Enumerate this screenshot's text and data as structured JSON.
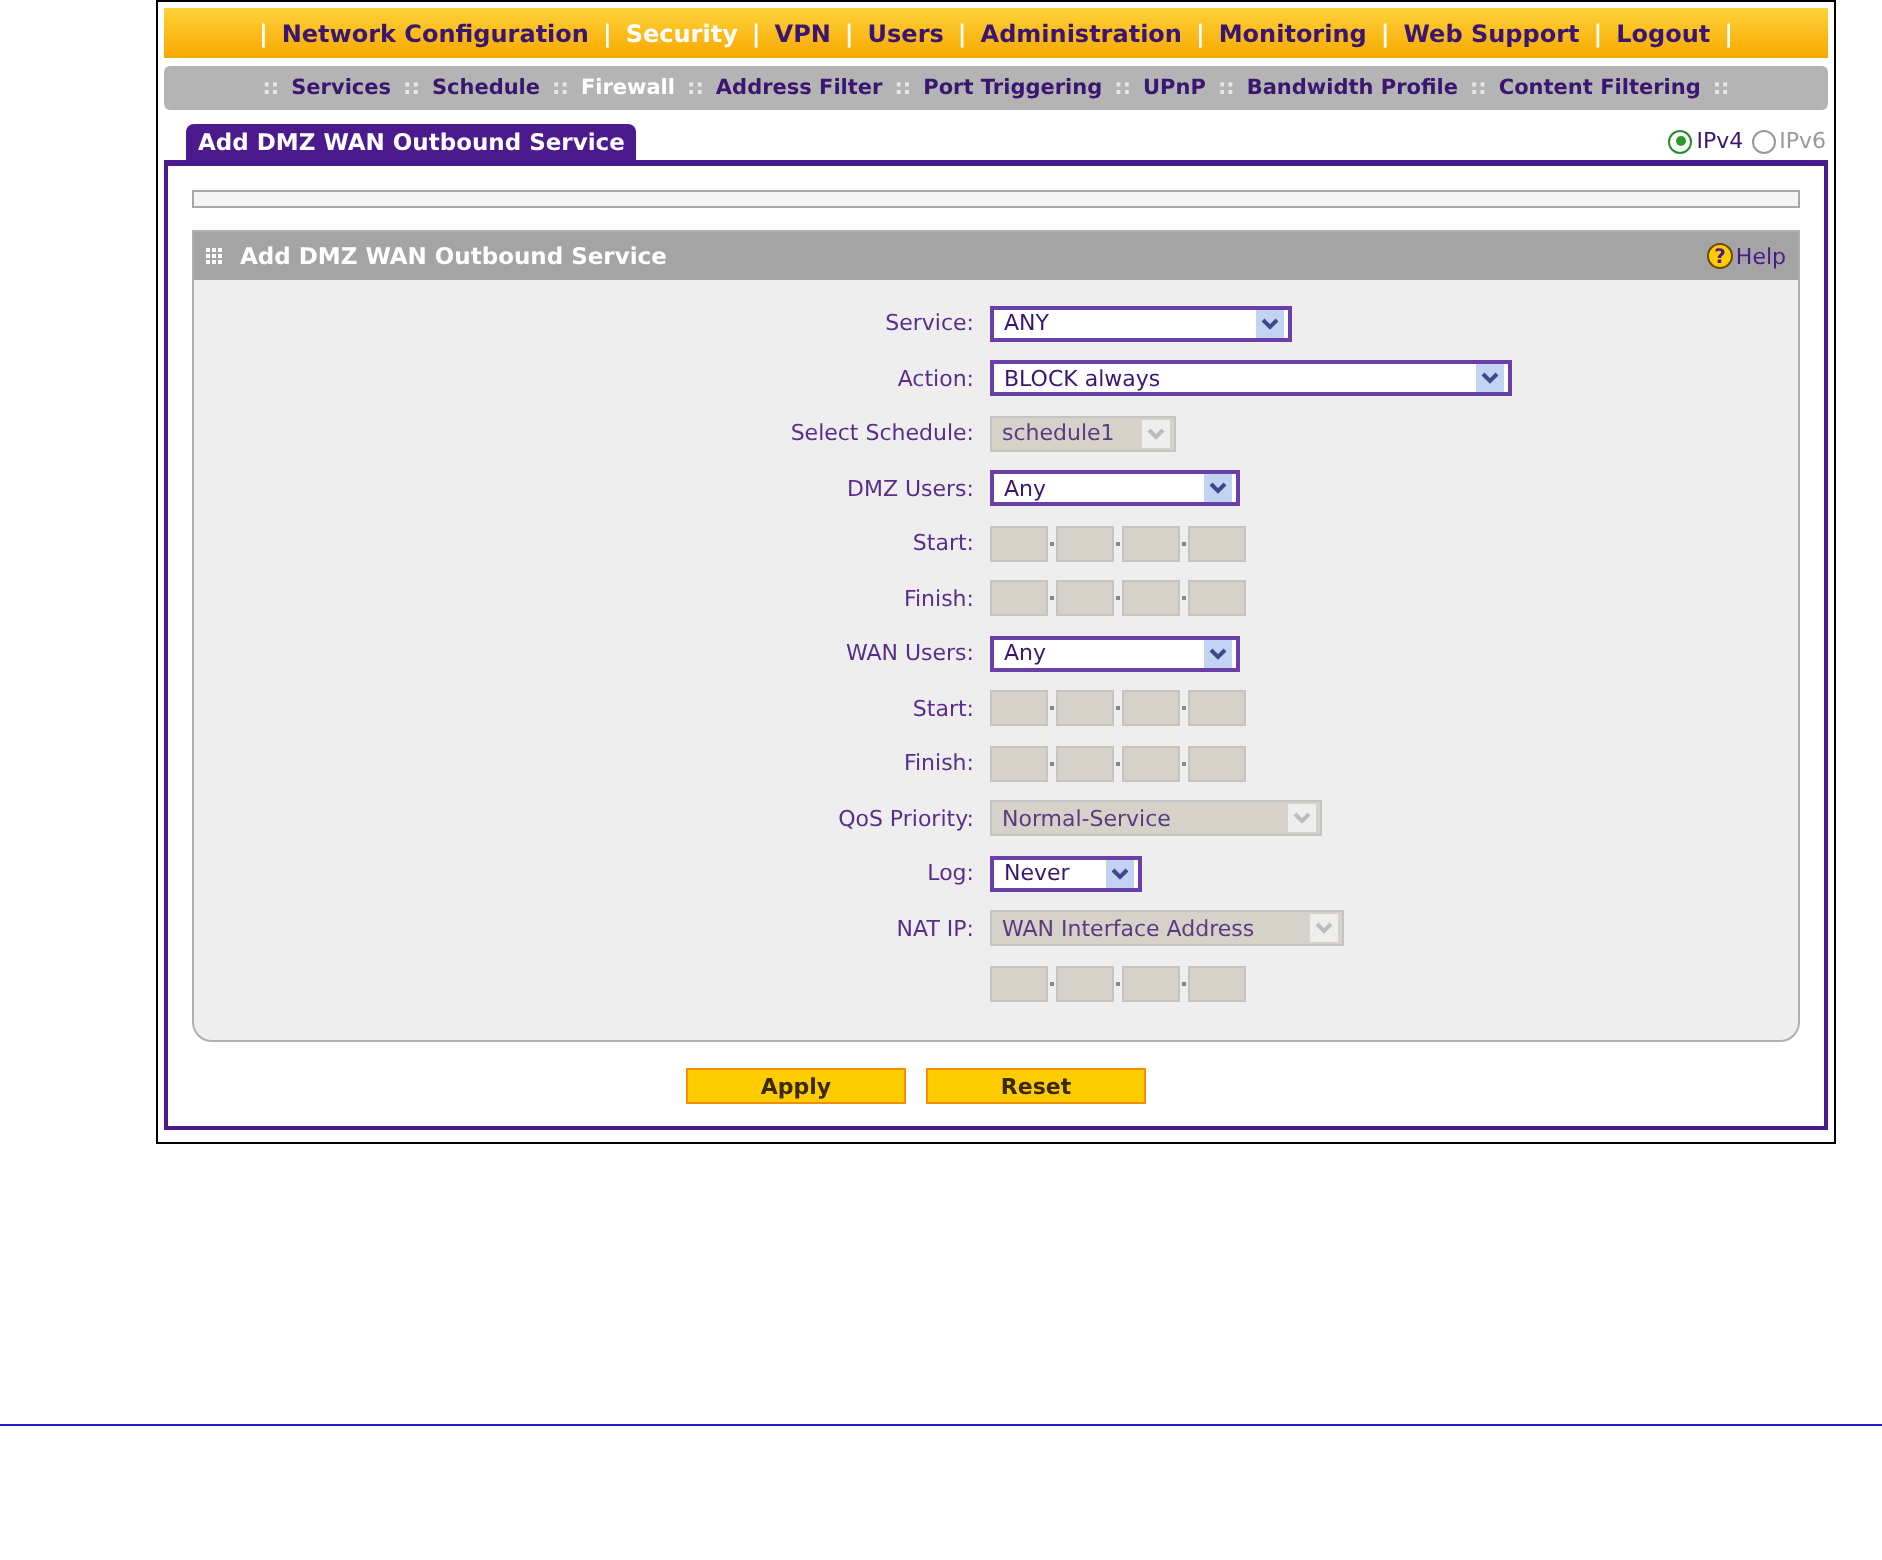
{
  "top_menu": [
    {
      "kind": "separator",
      "text": "|"
    },
    {
      "kind": "link",
      "label": "Network Configuration",
      "selected": false
    },
    {
      "kind": "separator",
      "text": "|"
    },
    {
      "kind": "link",
      "label": "Security",
      "selected": true
    },
    {
      "kind": "separator",
      "text": "|"
    },
    {
      "kind": "link",
      "label": "VPN",
      "selected": false
    },
    {
      "kind": "separator",
      "text": "|"
    },
    {
      "kind": "link",
      "label": "Users",
      "selected": false
    },
    {
      "kind": "separator",
      "text": "|"
    },
    {
      "kind": "link",
      "label": "Administration",
      "selected": false
    },
    {
      "kind": "separator",
      "text": "|"
    },
    {
      "kind": "link",
      "label": "Monitoring",
      "selected": false
    },
    {
      "kind": "separator",
      "text": "|"
    },
    {
      "kind": "link",
      "label": "Web Support",
      "selected": false
    },
    {
      "kind": "separator",
      "text": "|"
    },
    {
      "kind": "link",
      "label": "Logout",
      "selected": false
    },
    {
      "kind": "separator",
      "text": "|"
    }
  ],
  "sub_menu": [
    {
      "kind": "separator",
      "text": "::"
    },
    {
      "kind": "link",
      "label": "Services",
      "selected": false
    },
    {
      "kind": "separator",
      "text": "::"
    },
    {
      "kind": "link",
      "label": "Schedule",
      "selected": false
    },
    {
      "kind": "separator",
      "text": "::"
    },
    {
      "kind": "link",
      "label": "Firewall",
      "selected": true
    },
    {
      "kind": "separator",
      "text": "::"
    },
    {
      "kind": "link",
      "label": "Address Filter",
      "selected": false
    },
    {
      "kind": "separator",
      "text": "::"
    },
    {
      "kind": "link",
      "label": "Port Triggering",
      "selected": false
    },
    {
      "kind": "separator",
      "text": "::"
    },
    {
      "kind": "link",
      "label": "UPnP",
      "selected": false
    },
    {
      "kind": "separator",
      "text": "::"
    },
    {
      "kind": "link",
      "label": "Bandwidth Profile",
      "selected": false
    },
    {
      "kind": "separator",
      "text": "::"
    },
    {
      "kind": "link",
      "label": "Content Filtering",
      "selected": false
    },
    {
      "kind": "separator",
      "text": "::"
    }
  ],
  "page_tab": {
    "label": "Add DMZ WAN Outbound Service",
    "selected": true
  },
  "ip_version": [
    {
      "label": "IPv4",
      "selected": true
    },
    {
      "label": "IPv6",
      "selected": false
    }
  ],
  "section": {
    "title": "Add DMZ WAN Outbound Service",
    "help": "Help",
    "help_mark": "?"
  },
  "form": [
    {
      "kind": "select",
      "label": "Service:",
      "value": "ANY",
      "disabled": false
    },
    {
      "kind": "select",
      "label": "Action:",
      "value": "BLOCK always",
      "disabled": false
    },
    {
      "kind": "select",
      "label": "Select Schedule:",
      "value": "schedule1",
      "disabled": true
    },
    {
      "kind": "select",
      "label": "DMZ Users:",
      "value": "Any",
      "disabled": false
    },
    {
      "kind": "ip",
      "label": "Start:",
      "disabled": true
    },
    {
      "kind": "ip",
      "label": "Finish:",
      "disabled": true
    },
    {
      "kind": "select",
      "label": "WAN Users:",
      "value": "Any",
      "disabled": false
    },
    {
      "kind": "ip",
      "label": "Start:",
      "disabled": true
    },
    {
      "kind": "ip",
      "label": "Finish:",
      "disabled": true
    },
    {
      "kind": "select",
      "label": "QoS Priority:",
      "value": "Normal-Service",
      "disabled": true
    },
    {
      "kind": "select",
      "label": "Log:",
      "value": "Never",
      "disabled": false
    },
    {
      "kind": "select",
      "label": "NAT IP:",
      "value": "WAN Interface Address",
      "disabled": true
    },
    {
      "kind": "ip",
      "disabled": true
    }
  ],
  "buttons": [
    "Apply",
    "Reset"
  ]
}
